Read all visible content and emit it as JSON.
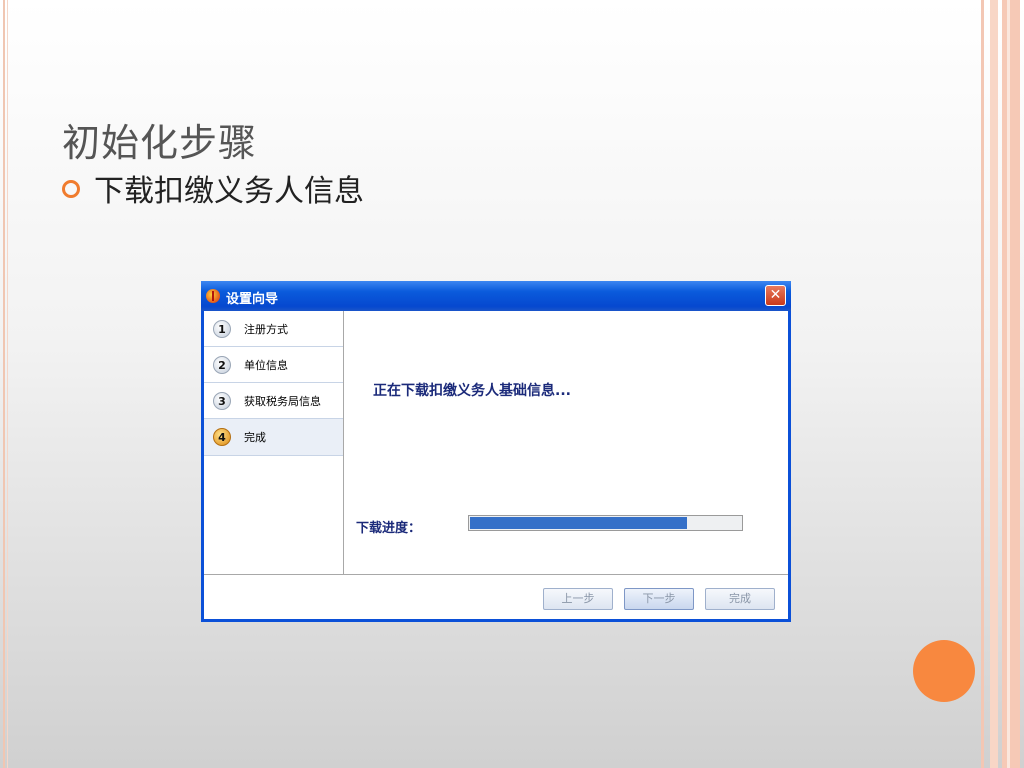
{
  "slide": {
    "title": "初始化步骤",
    "bullet": "下载扣缴义务人信息",
    "accent_color": "#f8883f"
  },
  "dialog": {
    "title": "设置向导",
    "close_label": "✕",
    "steps": [
      {
        "num": "1",
        "label": "注册方式"
      },
      {
        "num": "2",
        "label": "单位信息"
      },
      {
        "num": "3",
        "label": "获取税务局信息"
      },
      {
        "num": "4",
        "label": "完成"
      }
    ],
    "active_step": 4,
    "message": "正在下载扣缴义务人基础信息...",
    "progress_label": "下载进度：",
    "progress_fraction": 0.8,
    "buttons": {
      "prev": "上一步",
      "next": "下一步",
      "finish": "完成"
    }
  }
}
